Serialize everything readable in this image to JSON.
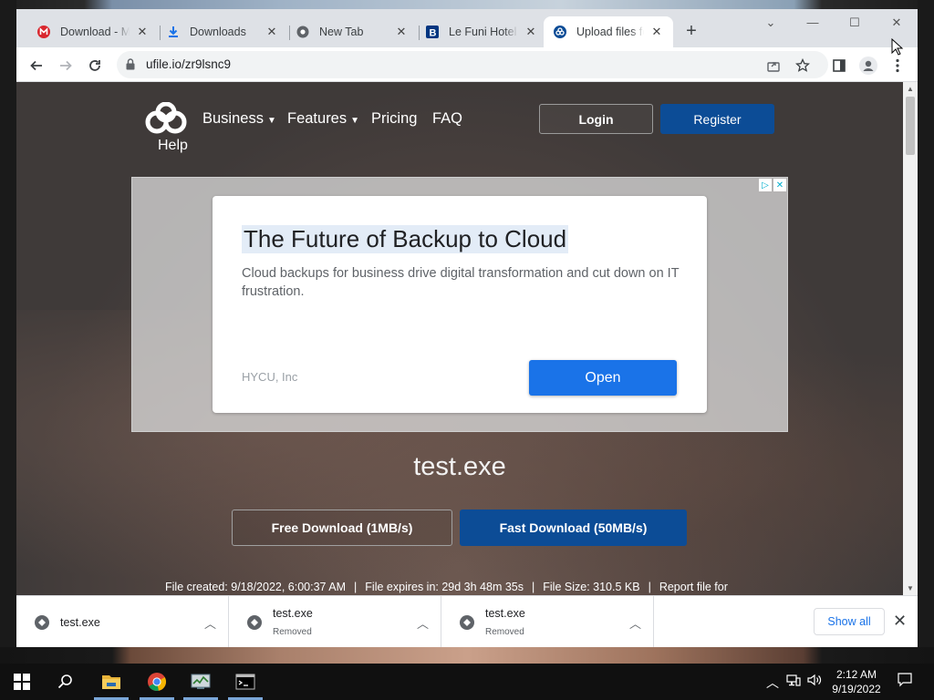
{
  "browser": {
    "tabs": [
      {
        "title": "Download - M",
        "favicon": "mega-icon",
        "color": "#d9272e"
      },
      {
        "title": "Downloads",
        "favicon": "download-icon",
        "color": "#1a73e8"
      },
      {
        "title": "New Tab",
        "favicon": "chrome-icon",
        "color": "#5f6368"
      },
      {
        "title": "Le Funi Hotel, ",
        "favicon": "booking-icon",
        "color": "#003580"
      },
      {
        "title": "Upload files fo",
        "favicon": "ufile-icon",
        "color": "#0c4c96",
        "active": true
      }
    ],
    "url": "ufile.io/zr9lsnc9"
  },
  "site": {
    "help_label": "Help",
    "nav": {
      "business": "Business",
      "features": "Features",
      "pricing": "Pricing",
      "faq": "FAQ"
    },
    "login_label": "Login",
    "register_label": "Register",
    "brand_color": "#0c4c96"
  },
  "ad": {
    "title": "The Future of Backup to Cloud",
    "description": "Cloud backups for business drive digital transformation and cut down on IT frustration.",
    "sponsor": "HYCU, Inc",
    "cta": "Open"
  },
  "file": {
    "name": "test.exe",
    "free_download_label": "Free Download (1MB/s)",
    "fast_download_label": "Fast Download (50MB/s)",
    "created": "File created: 9/18/2022, 6:00:37 AM",
    "expires": "File expires in: 29d 3h 48m 35s",
    "size": "File Size: 310.5 KB",
    "report": "Report file for"
  },
  "downloads": {
    "items": [
      {
        "name": "test.exe",
        "status": ""
      },
      {
        "name": "test.exe",
        "status": "Removed"
      },
      {
        "name": "test.exe",
        "status": "Removed"
      }
    ],
    "show_all_label": "Show all"
  },
  "taskbar": {
    "time": "2:12 AM",
    "date": "9/19/2022",
    "pinned": [
      "windows-start-icon",
      "search-icon",
      "file-explorer-icon",
      "chrome-icon",
      "task-manager-icon",
      "terminal-icon"
    ]
  }
}
